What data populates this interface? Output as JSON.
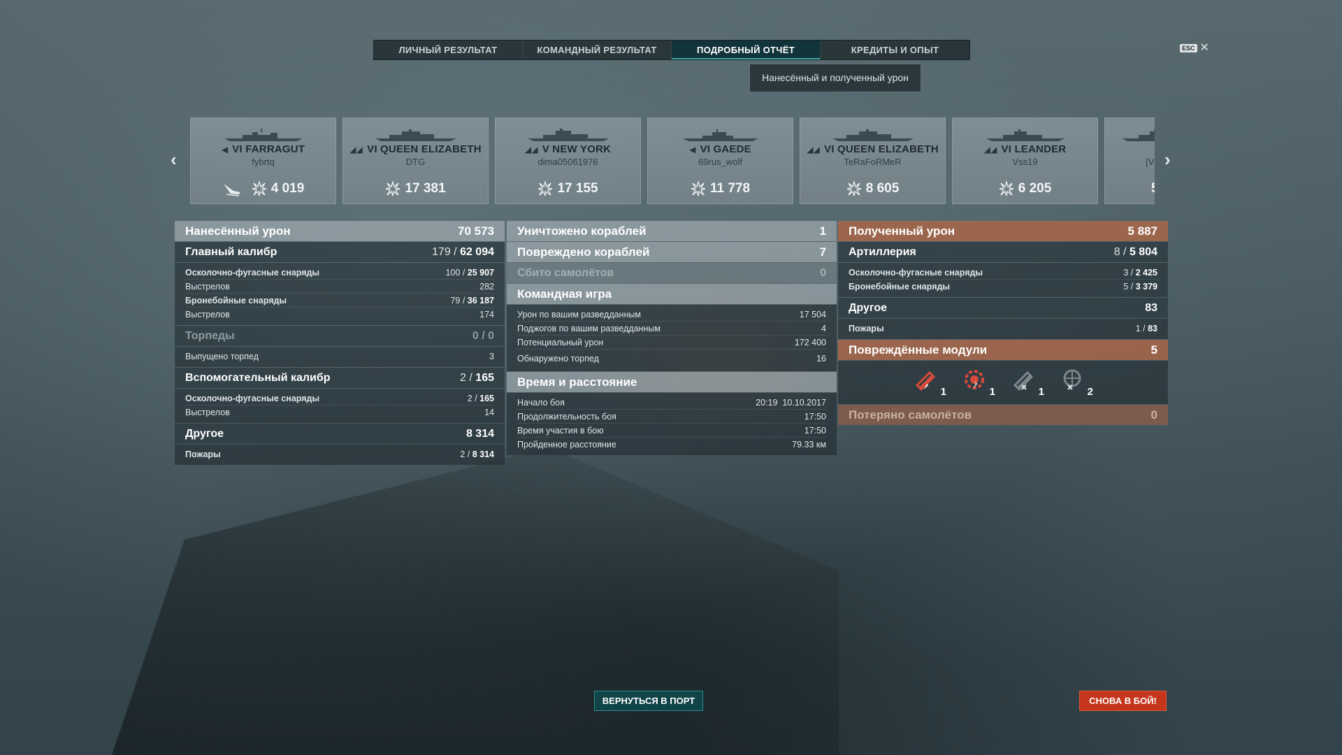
{
  "tabs": [
    {
      "label": "ЛИЧНЫЙ РЕЗУЛЬТАТ",
      "active": false
    },
    {
      "label": "КОМАНДНЫЙ РЕЗУЛЬТАТ",
      "active": false
    },
    {
      "label": "ПОДРОБНЫЙ ОТЧЁТ",
      "active": true
    },
    {
      "label": "КРЕДИТЫ И ОПЫТ",
      "active": false
    }
  ],
  "tooltip": "Нанесённый и полученный урон",
  "esc_label": "ESC",
  "close_glyph": "✕",
  "ships": [
    {
      "name": "VI FARRAGUT",
      "player": "fybrtq",
      "damage": "4 019",
      "class_icon": "destroyer-icon",
      "extra_icon": "plane-shot-icon"
    },
    {
      "name": "VI QUEEN ELIZABETH",
      "player": "DTG",
      "damage": "17 381",
      "class_icon": "battleship-icon"
    },
    {
      "name": "V NEW YORK",
      "player": "dima05061976",
      "damage": "17 155",
      "class_icon": "battleship-icon"
    },
    {
      "name": "VI GAEDE",
      "player": "69rus_wolf",
      "damage": "11 778",
      "class_icon": "destroyer-icon"
    },
    {
      "name": "VI QUEEN ELIZABETH",
      "player": "TeRaFoRMeR",
      "damage": "8 605",
      "class_icon": "battleship-icon"
    },
    {
      "name": "VI LEANDER",
      "player": "Vss19",
      "damage": "6 205",
      "class_icon": "cruiser-icon"
    },
    {
      "name": "",
      "player": "[V",
      "damage": "5",
      "class_icon": "cruiser-icon"
    }
  ],
  "left": {
    "dealt": {
      "label": "Нанесённый урон",
      "value": "70 573"
    },
    "main": {
      "label": "Главный калибр",
      "hits": "179",
      "value": "62 094"
    },
    "main_lines": [
      {
        "label": "Осколочно-фугасные снаряды",
        "hits": "100",
        "value": "25 907",
        "bold": true
      },
      {
        "label": "Выстрелов",
        "value": "282"
      },
      {
        "label": "Бронебойные снаряды",
        "hits": "79",
        "value": "36 187",
        "bold": true
      },
      {
        "label": "Выстрелов",
        "value": "174"
      }
    ],
    "torp": {
      "label": "Торпеды",
      "value": "0 / 0"
    },
    "torp_lines": [
      {
        "label": "Выпущено торпед",
        "value": "3"
      }
    ],
    "secondary": {
      "label": "Вспомогательный калибр",
      "hits": "2",
      "value": "165"
    },
    "secondary_lines": [
      {
        "label": "Осколочно-фугасные снаряды",
        "hits": "2",
        "value": "165",
        "bold": true
      },
      {
        "label": "Выстрелов",
        "value": "14"
      }
    ],
    "other": {
      "label": "Другое",
      "value": "8 314"
    },
    "other_lines": [
      {
        "label": "Пожары",
        "hits": "2",
        "value": "8 314",
        "bold": true
      }
    ]
  },
  "middle": {
    "destroyed": {
      "label": "Уничтожено кораблей",
      "value": "1"
    },
    "damaged": {
      "label": "Повреждено кораблей",
      "value": "7"
    },
    "planes": {
      "label": "Сбито самолётов",
      "value": "0"
    },
    "team": {
      "label": "Командная игра"
    },
    "team_lines": [
      {
        "label": "Урон по вашим разведданным",
        "value": "17 504"
      },
      {
        "label": "Поджогов по вашим разведданным",
        "value": "4"
      },
      {
        "label": "Потенциальный урон",
        "value": "172 400"
      },
      {
        "label": "Обнаружено торпед",
        "value": "16"
      }
    ],
    "time": {
      "label": "Время и расстояние"
    },
    "time_lines": [
      {
        "label": "Начало боя",
        "value": "20:19  10.10.2017"
      },
      {
        "label": "Продолжительность боя",
        "value": "17:50"
      },
      {
        "label": "Время участия в бою",
        "value": "17:50"
      },
      {
        "label": "Пройденное расстояние",
        "value": "79.33 км"
      }
    ]
  },
  "right": {
    "received": {
      "label": "Полученный урон",
      "value": "5 887"
    },
    "artillery": {
      "label": "Артиллерия",
      "hits": "8",
      "value": "5 804"
    },
    "artillery_lines": [
      {
        "label": "Осколочно-фугасные снаряды",
        "hits": "3",
        "value": "2 425",
        "bold": true
      },
      {
        "label": "Бронебойные снаряды",
        "hits": "5",
        "value": "3 379",
        "bold": true
      }
    ],
    "other": {
      "label": "Другое",
      "value": "83"
    },
    "other_lines": [
      {
        "label": "Пожары",
        "hits": "1",
        "value": "83",
        "bold": true
      }
    ],
    "modules": {
      "label": "Повреждённые модули",
      "value": "5"
    },
    "module_icons": [
      {
        "icon": "main-battery-damaged-icon",
        "count": "1",
        "color": "#d84a3a"
      },
      {
        "icon": "engine-damaged-icon",
        "count": "1",
        "color": "#d84a3a"
      },
      {
        "icon": "main-battery-destroyed-icon",
        "count": "1",
        "color": "#7b878c"
      },
      {
        "icon": "aa-destroyed-icon",
        "count": "2",
        "color": "#7b878c"
      }
    ],
    "planes_lost": {
      "label": "Потеряно самолётов",
      "value": "0"
    }
  },
  "buttons": {
    "port": "ВЕРНУТЬСЯ В ПОРТ",
    "battle": "СНОВА В БОЙ!"
  },
  "colors": {
    "accent_teal": "#2f8d88",
    "battle_red": "#c5351c",
    "received_orange": "#a86648"
  }
}
